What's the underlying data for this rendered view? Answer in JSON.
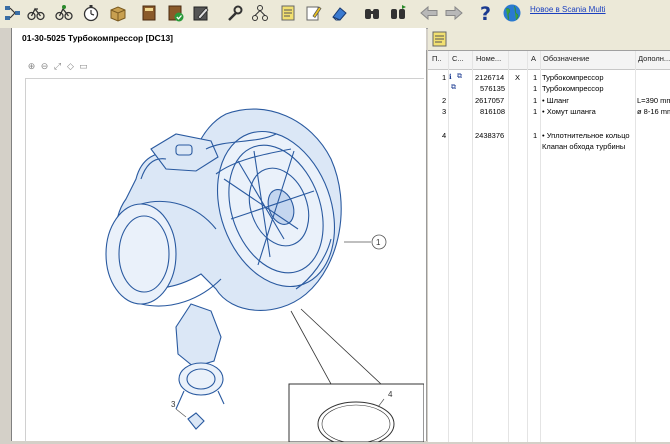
{
  "toolbar": {
    "buttons": [
      {
        "name": "structure-icon"
      },
      {
        "name": "bicycle-icon"
      },
      {
        "name": "stopwatch-icon"
      },
      {
        "name": "box-icon"
      },
      {
        "name": "book-icon"
      },
      {
        "name": "book-check-icon"
      },
      {
        "name": "edit-note-icon"
      },
      {
        "name": "wrench-icon"
      },
      {
        "name": "diagram-tool-icon"
      },
      {
        "name": "document-icon"
      },
      {
        "name": "pencil-doc-icon"
      },
      {
        "name": "eraser-icon"
      },
      {
        "name": "binoculars-icon"
      },
      {
        "name": "binoculars-next-icon"
      },
      {
        "name": "back-arrow-icon"
      },
      {
        "name": "forward-arrow-icon"
      },
      {
        "name": "help-icon"
      },
      {
        "name": "globe-icon"
      }
    ],
    "news_link": "Новое в Scania Multi"
  },
  "header": {
    "title": "01-30-5025 Турбокомпрессор [DC13]"
  },
  "table": {
    "columns": [
      "П..",
      "С...",
      "Номе...",
      "",
      "А",
      "Обозначение",
      "Дополн..."
    ],
    "rows": [
      {
        "pos": "1",
        "icons": true,
        "number": "2126714",
        "x": "X",
        "qty": "1",
        "name": "Турбокомпрессор",
        "extra": ""
      },
      {
        "pos": "",
        "icons": true,
        "number": "576135",
        "x": "",
        "qty": "1",
        "name": "Турбокомпрессор",
        "extra": ""
      },
      {
        "pos": "2",
        "icons": false,
        "number": "2617057",
        "x": "",
        "qty": "1",
        "name": "• Шланг",
        "extra": "L=390 mm"
      },
      {
        "pos": "3",
        "icons": false,
        "number": "816108",
        "x": "",
        "qty": "1",
        "name": "• Хомут шланга",
        "extra": "ø 8-16 mm"
      },
      {
        "pos": "",
        "icons": false,
        "number": "",
        "x": "",
        "qty": "",
        "name": "",
        "extra": ""
      },
      {
        "pos": "4",
        "icons": false,
        "number": "2438376",
        "x": "",
        "qty": "1",
        "name": "• Уплотнительное кольцо",
        "extra": ""
      },
      {
        "pos": "",
        "icons": false,
        "number": "",
        "x": "",
        "qty": "",
        "name": "Клапан обхода турбины",
        "extra": ""
      }
    ]
  },
  "drawing": {
    "callouts": [
      "1",
      "3",
      "4"
    ]
  },
  "colors": {
    "drawing_line": "#2a5aa0",
    "drawing_fill": "#dbe7f6",
    "link": "#1a3fbf"
  }
}
